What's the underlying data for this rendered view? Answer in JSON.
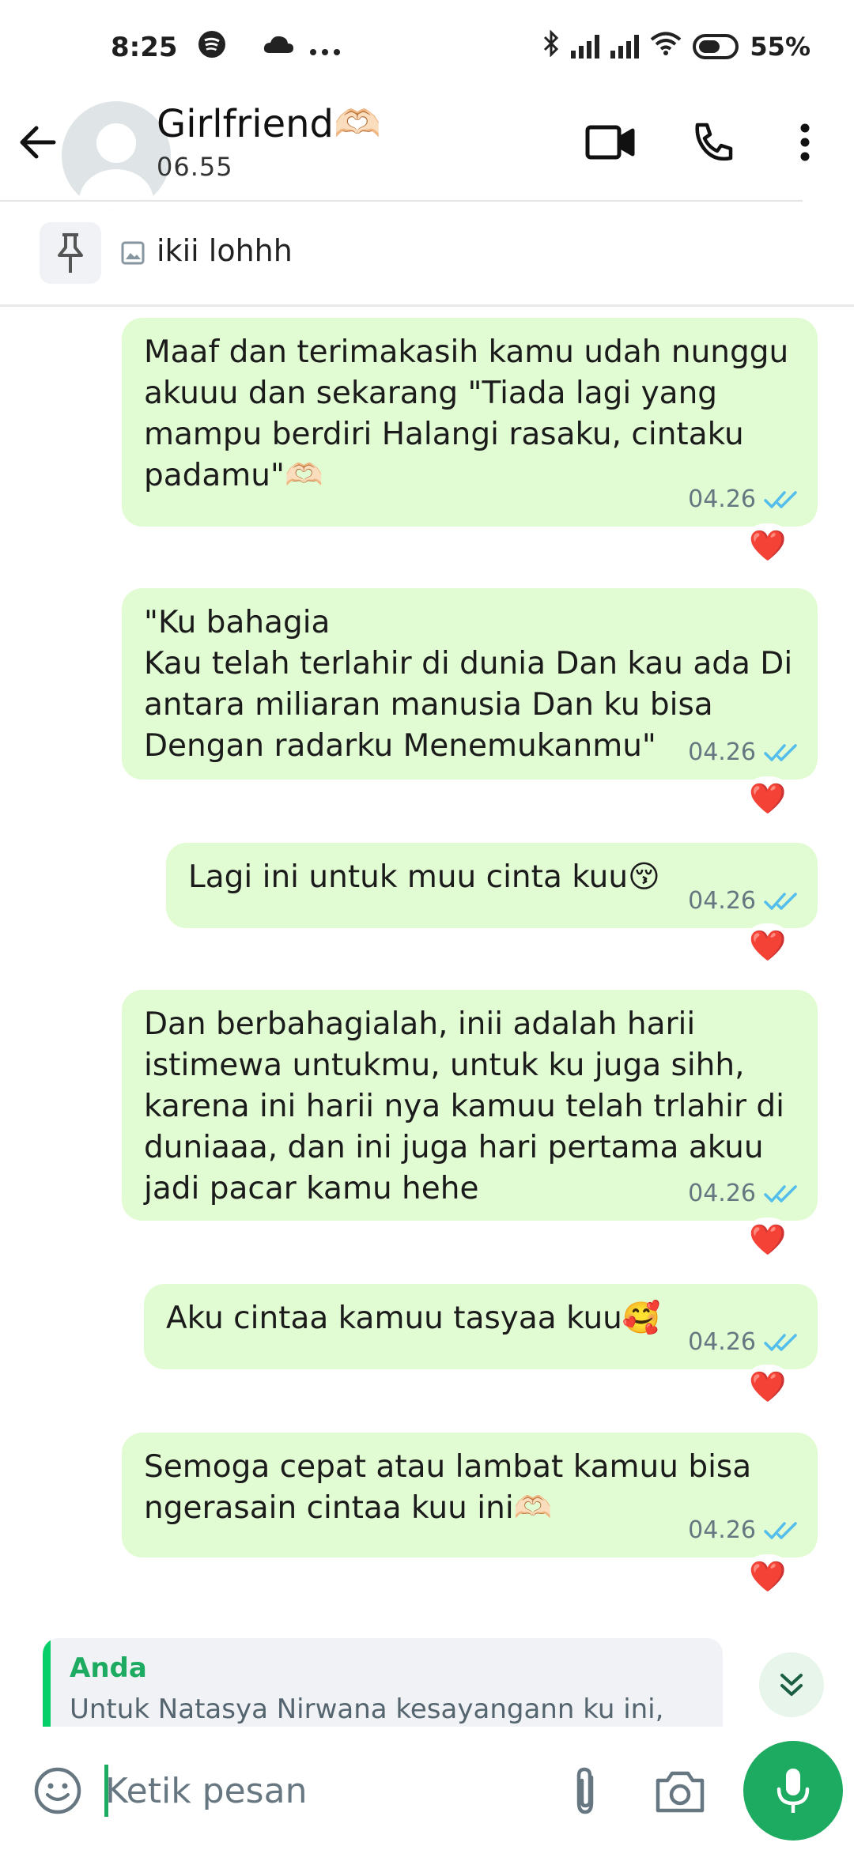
{
  "status_bar": {
    "time": "8:25",
    "battery": "55%",
    "icons": [
      "spotify-icon",
      "cloud-icon",
      "more-dots-icon",
      "bluetooth-icon",
      "signal-icon",
      "signal-icon",
      "wifi-icon",
      "battery-icon"
    ]
  },
  "header": {
    "name": "Girlfriend",
    "name_emoji": "🫶🏻",
    "status": "06.55",
    "icons": [
      "back-arrow-icon",
      "video-call-icon",
      "phone-call-icon",
      "more-vert-icon"
    ]
  },
  "pinned": {
    "text": "ikii lohhh",
    "icons": [
      "pin-icon",
      "image-icon"
    ]
  },
  "messages": [
    {
      "text": "Maaf dan terimakasih kamu udah nunggu akuuu dan sekarang \"Tiada lagi yang mampu berdiri Halangi rasaku, cintaku padamu\"🫶🏻",
      "time": "04.26",
      "status": "read",
      "reaction": "❤️"
    },
    {
      "text": "\"Ku bahagia\nKau telah terlahir di dunia Dan kau ada Di antara miliaran manusia Dan ku bisa Dengan radarku Menemukanmu\"",
      "time": "04.26",
      "status": "read",
      "reaction": "❤️"
    },
    {
      "text": "Lagi ini untuk muu cinta kuu😚",
      "time": "04.26",
      "status": "read",
      "reaction": "❤️"
    },
    {
      "text": "Dan berbahagialah, inii adalah harii istimewa untukmu, untuk ku juga sihh, karena ini harii nya kamuu telah trlahir di duniaaa, dan ini juga hari pertama akuu jadi pacar kamu hehe",
      "time": "04.26",
      "status": "read",
      "reaction": "❤️"
    },
    {
      "text": "Aku cintaa kamuu tasyaa kuu🥰",
      "time": "04.26",
      "status": "read",
      "reaction": "❤️"
    },
    {
      "text": "Semoga cepat atau lambat kamuu bisa ngerasain cintaa kuu ini🫶🏻",
      "time": "04.26",
      "status": "read",
      "reaction": "❤️"
    }
  ],
  "reply_preview": {
    "author": "Anda",
    "text": "Untuk Natasya Nirwana kesayangann ku ini,"
  },
  "input": {
    "placeholder": "Ketik pesan"
  },
  "colors": {
    "outgoing_bubble": "#e1fcd2",
    "accent_green": "#1daa61",
    "read_ticks": "#53bdeb",
    "reaction_heart": "#e0262f"
  }
}
